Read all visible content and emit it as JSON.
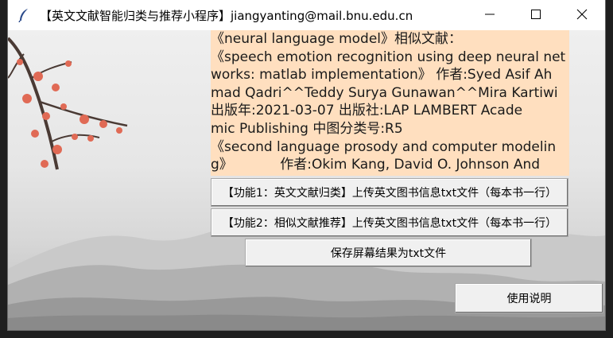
{
  "window": {
    "title": "【英文文献智能归类与推荐小程序】jiangyanting@mail.bnu.edu.cn",
    "app_icon": "feather-icon",
    "controls": [
      "minimize-icon",
      "maximize-icon",
      "close-icon"
    ]
  },
  "result_box": {
    "lines": [
      "《neural language model》相似文献：",
      "《speech emotion recognition using deep neural net",
      "works: matlab implementation》 作者:Syed Asif Ah",
      "mad Qadri^^Teddy Surya Gunawan^^Mira Kartiwi",
      "出版年:2021-03-07 出版社:LAP LAMBERT Acade",
      "mic Publishing 中图分类号:R5",
      "《second language prosody and computer modelin",
      "g》           作者:Okim Kang, David O. Johnson And"
    ],
    "background": "#ffdfbf"
  },
  "buttons": {
    "func1": "【功能1：英文文献归类】上传英文图书信息txt文件（每本书一行）",
    "func2": "【功能2：相似文献推荐】上传英文图书信息txt文件（每本书一行）",
    "save": "保存屏幕结果为txt文件",
    "help": "使用说明"
  }
}
